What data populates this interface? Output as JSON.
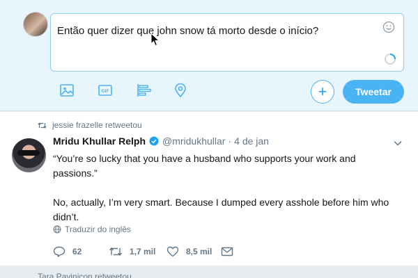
{
  "composer": {
    "text": "Então quer dizer que john snow tá morto desde o início?",
    "tweet_button": "Tweetar",
    "add_button": "+",
    "tools": [
      "image-icon",
      "gif-icon",
      "poll-icon",
      "location-icon"
    ]
  },
  "tweet": {
    "retweeted_by": "jessie frazelle retweetou",
    "author_name": "Mridu Khullar Relph",
    "handle": "@mridukhullar",
    "separator": "·",
    "time": "4 de jan",
    "paragraph_1": "“You’re so lucky that you have a husband who supports your work and passions.”",
    "paragraph_2": "No, actually, I’m very smart. Because I dumped every asshole before him who didn’t.",
    "translate": "Traduzir do inglês",
    "replies": "62",
    "retweets": "1,7 mil",
    "likes": "8,5 mil"
  },
  "next_retweet": "Tara Pavinicon retweetou",
  "colors": {
    "accent": "#1da1f2",
    "button": "#4ab3f4",
    "verified": "#1da1f2",
    "muted": "#657786"
  }
}
